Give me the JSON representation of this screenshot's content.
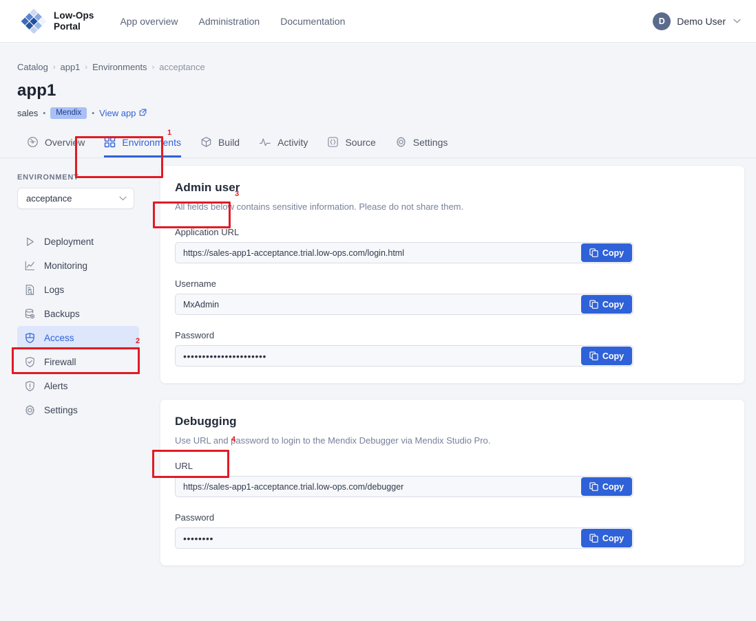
{
  "topnav": {
    "brand_line1": "Low-Ops",
    "brand_line2": "Portal",
    "logo_icon": "diamond-grid-logo",
    "links": [
      {
        "label": "App overview"
      },
      {
        "label": "Administration"
      },
      {
        "label": "Documentation"
      }
    ],
    "user": {
      "initial": "D",
      "name": "Demo User",
      "caret_icon": "chevron-down-icon"
    }
  },
  "breadcrumb": {
    "items": [
      {
        "label": "Catalog"
      },
      {
        "label": "app1"
      },
      {
        "label": "Environments"
      },
      {
        "label": "acceptance"
      }
    ],
    "separator": "›"
  },
  "header": {
    "title": "app1",
    "team": "sales",
    "dot": "•",
    "badge": "Mendix",
    "view_app": "View app",
    "external_link_icon": "external-link-icon"
  },
  "tabs": [
    {
      "label": "Overview",
      "icon": "gauge-icon",
      "active": false
    },
    {
      "label": "Environments",
      "icon": "grid-icon",
      "active": true
    },
    {
      "label": "Build",
      "icon": "box-icon",
      "active": false
    },
    {
      "label": "Activity",
      "icon": "pulse-icon",
      "active": false
    },
    {
      "label": "Source",
      "icon": "braces-icon",
      "active": false
    },
    {
      "label": "Settings",
      "icon": "gear-icon",
      "active": false
    }
  ],
  "sidebar": {
    "section_label": "ENVIRONMENT",
    "env_selected": "acceptance",
    "env_caret_icon": "chevron-down-icon",
    "items": [
      {
        "label": "Deployment",
        "icon": "play-icon",
        "active": false
      },
      {
        "label": "Monitoring",
        "icon": "line-chart-icon",
        "active": false
      },
      {
        "label": "Logs",
        "icon": "document-search-icon",
        "active": false
      },
      {
        "label": "Backups",
        "icon": "database-gear-icon",
        "active": false
      },
      {
        "label": "Access",
        "icon": "shield-key-icon",
        "active": true
      },
      {
        "label": "Firewall",
        "icon": "shield-check-icon",
        "active": false
      },
      {
        "label": "Alerts",
        "icon": "shield-alert-icon",
        "active": false
      },
      {
        "label": "Settings",
        "icon": "gear-icon",
        "active": false
      }
    ]
  },
  "cards": {
    "admin_user": {
      "title": "Admin user",
      "subtitle": "All fields below contains sensitive information. Please do not share them.",
      "fields": [
        {
          "label": "Application URL",
          "value": "https://sales-app1-acceptance.trial.low-ops.com/login.html",
          "masked": false,
          "copy_label": "Copy"
        },
        {
          "label": "Username",
          "value": "MxAdmin",
          "masked": false,
          "copy_label": "Copy"
        },
        {
          "label": "Password",
          "value": "••••••••••••••••••••••",
          "masked": true,
          "copy_label": "Copy"
        }
      ]
    },
    "debugging": {
      "title": "Debugging",
      "subtitle": "Use URL and password to login to the Mendix Debugger via Mendix Studio Pro.",
      "fields": [
        {
          "label": "URL",
          "value": "https://sales-app1-acceptance.trial.low-ops.com/debugger",
          "masked": false,
          "copy_label": "Copy"
        },
        {
          "label": "Password",
          "value": "••••••••",
          "masked": true,
          "copy_label": "Copy"
        }
      ]
    }
  },
  "annotations": [
    {
      "number": "1",
      "target": "environments-tab"
    },
    {
      "number": "2",
      "target": "sidebar-item-access"
    },
    {
      "number": "3",
      "target": "admin-user-title"
    },
    {
      "number": "4",
      "target": "debugging-title"
    }
  ],
  "colors": {
    "accent": "#2f62d8",
    "annotation": "#e01b24",
    "page_bg": "#f4f5f8",
    "badge_bg": "#a9c0f5"
  }
}
